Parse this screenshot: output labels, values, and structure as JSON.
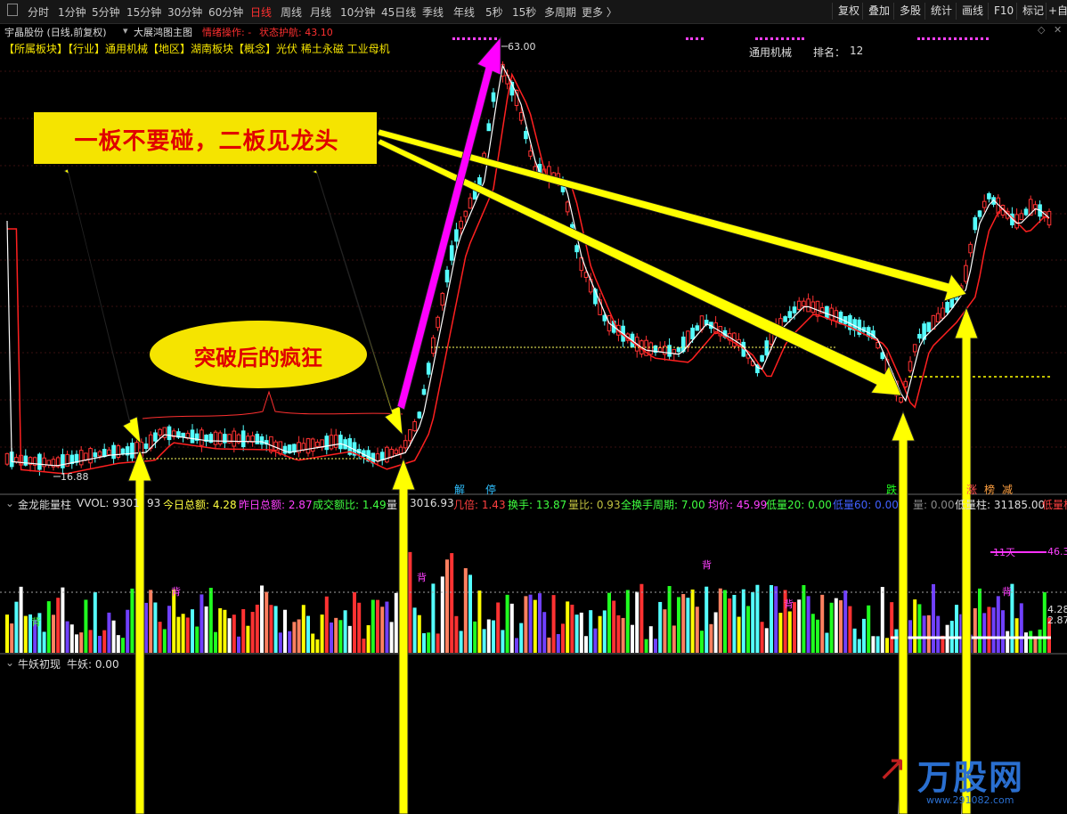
{
  "toolbar": {
    "periods": [
      "分时",
      "1分钟",
      "5分钟",
      "15分钟",
      "30分钟",
      "60分钟",
      "日线",
      "周线",
      "月线",
      "10分钟",
      "45日线",
      "季线",
      "年线",
      "5秒",
      "15秒",
      "多周期",
      "更多 〉"
    ],
    "active_period": "日线",
    "right_buttons": [
      "复权",
      "叠加",
      "多股",
      "统计",
      "画线",
      "F10",
      "标记",
      "+自"
    ]
  },
  "chart_title": {
    "stock": "宇晶股份 (日线,前复权)",
    "indicator": "大展鸿图主图",
    "mood_label": "情绪操作: -",
    "state_label": "状态护航: 43.10"
  },
  "concepts": "【所属板块】【行业】通用机械【地区】湖南板块【概念】光伏 稀土永磁 工业母机",
  "sector_rank": {
    "name": "通用机械",
    "rank_label": "排名：",
    "rank": "12"
  },
  "price_labels": {
    "high": "63.00",
    "low": "16.88"
  },
  "annotations": {
    "banner": "一板不要碰，二板见龙头",
    "ellipse": "突破后的疯狂"
  },
  "markers": {
    "jie": "解",
    "ting": "停",
    "die": "跌",
    "zhang": "涨",
    "bang": "榜",
    "jian": "减"
  },
  "volume_panel": {
    "name": "金龙能量柱",
    "vvol": "VVOL: 9301",
    "vvol_tail": "93",
    "today_amount": "今日总额: 4.28",
    "yesterday_amount": "昨日总额: 2.87",
    "amount_ratio": "成交额比: 1.49",
    "vol": "量",
    "vol_tail": "3016.93",
    "multiple": "几倍: 1.43",
    "turnover": "换手: 13.87",
    "vol_ratio": "量比: 0.93",
    "full_turnover": "全换手周期: 7.00",
    "avg_price": "均价: 45.99",
    "low_vol20": "低量20: 0.00",
    "low_vol60": "低量60: 0.00",
    "low_vol": "量: 0.00",
    "low_bar": "低量柱: 31185.00",
    "low_tail": "低量柱",
    "days": "11天",
    "right_v1": "46.3",
    "right_v2": "4.28",
    "right_v3": "2.87",
    "bei": "背"
  },
  "bottom_panel": {
    "name": "牛妖初现",
    "value": "牛妖: 0.00"
  },
  "watermark": {
    "logo": "万股网",
    "url": "www.291082.com"
  },
  "colors": {
    "up": "#ff3232",
    "down": "#54ffff",
    "ma5": "#ffffff",
    "ma10": "#ff2020",
    "arrow": "#ffff00",
    "arrow_magenta": "#ff00ff",
    "banner_bg": "#f5e400",
    "banner_text": "#e00000"
  }
}
